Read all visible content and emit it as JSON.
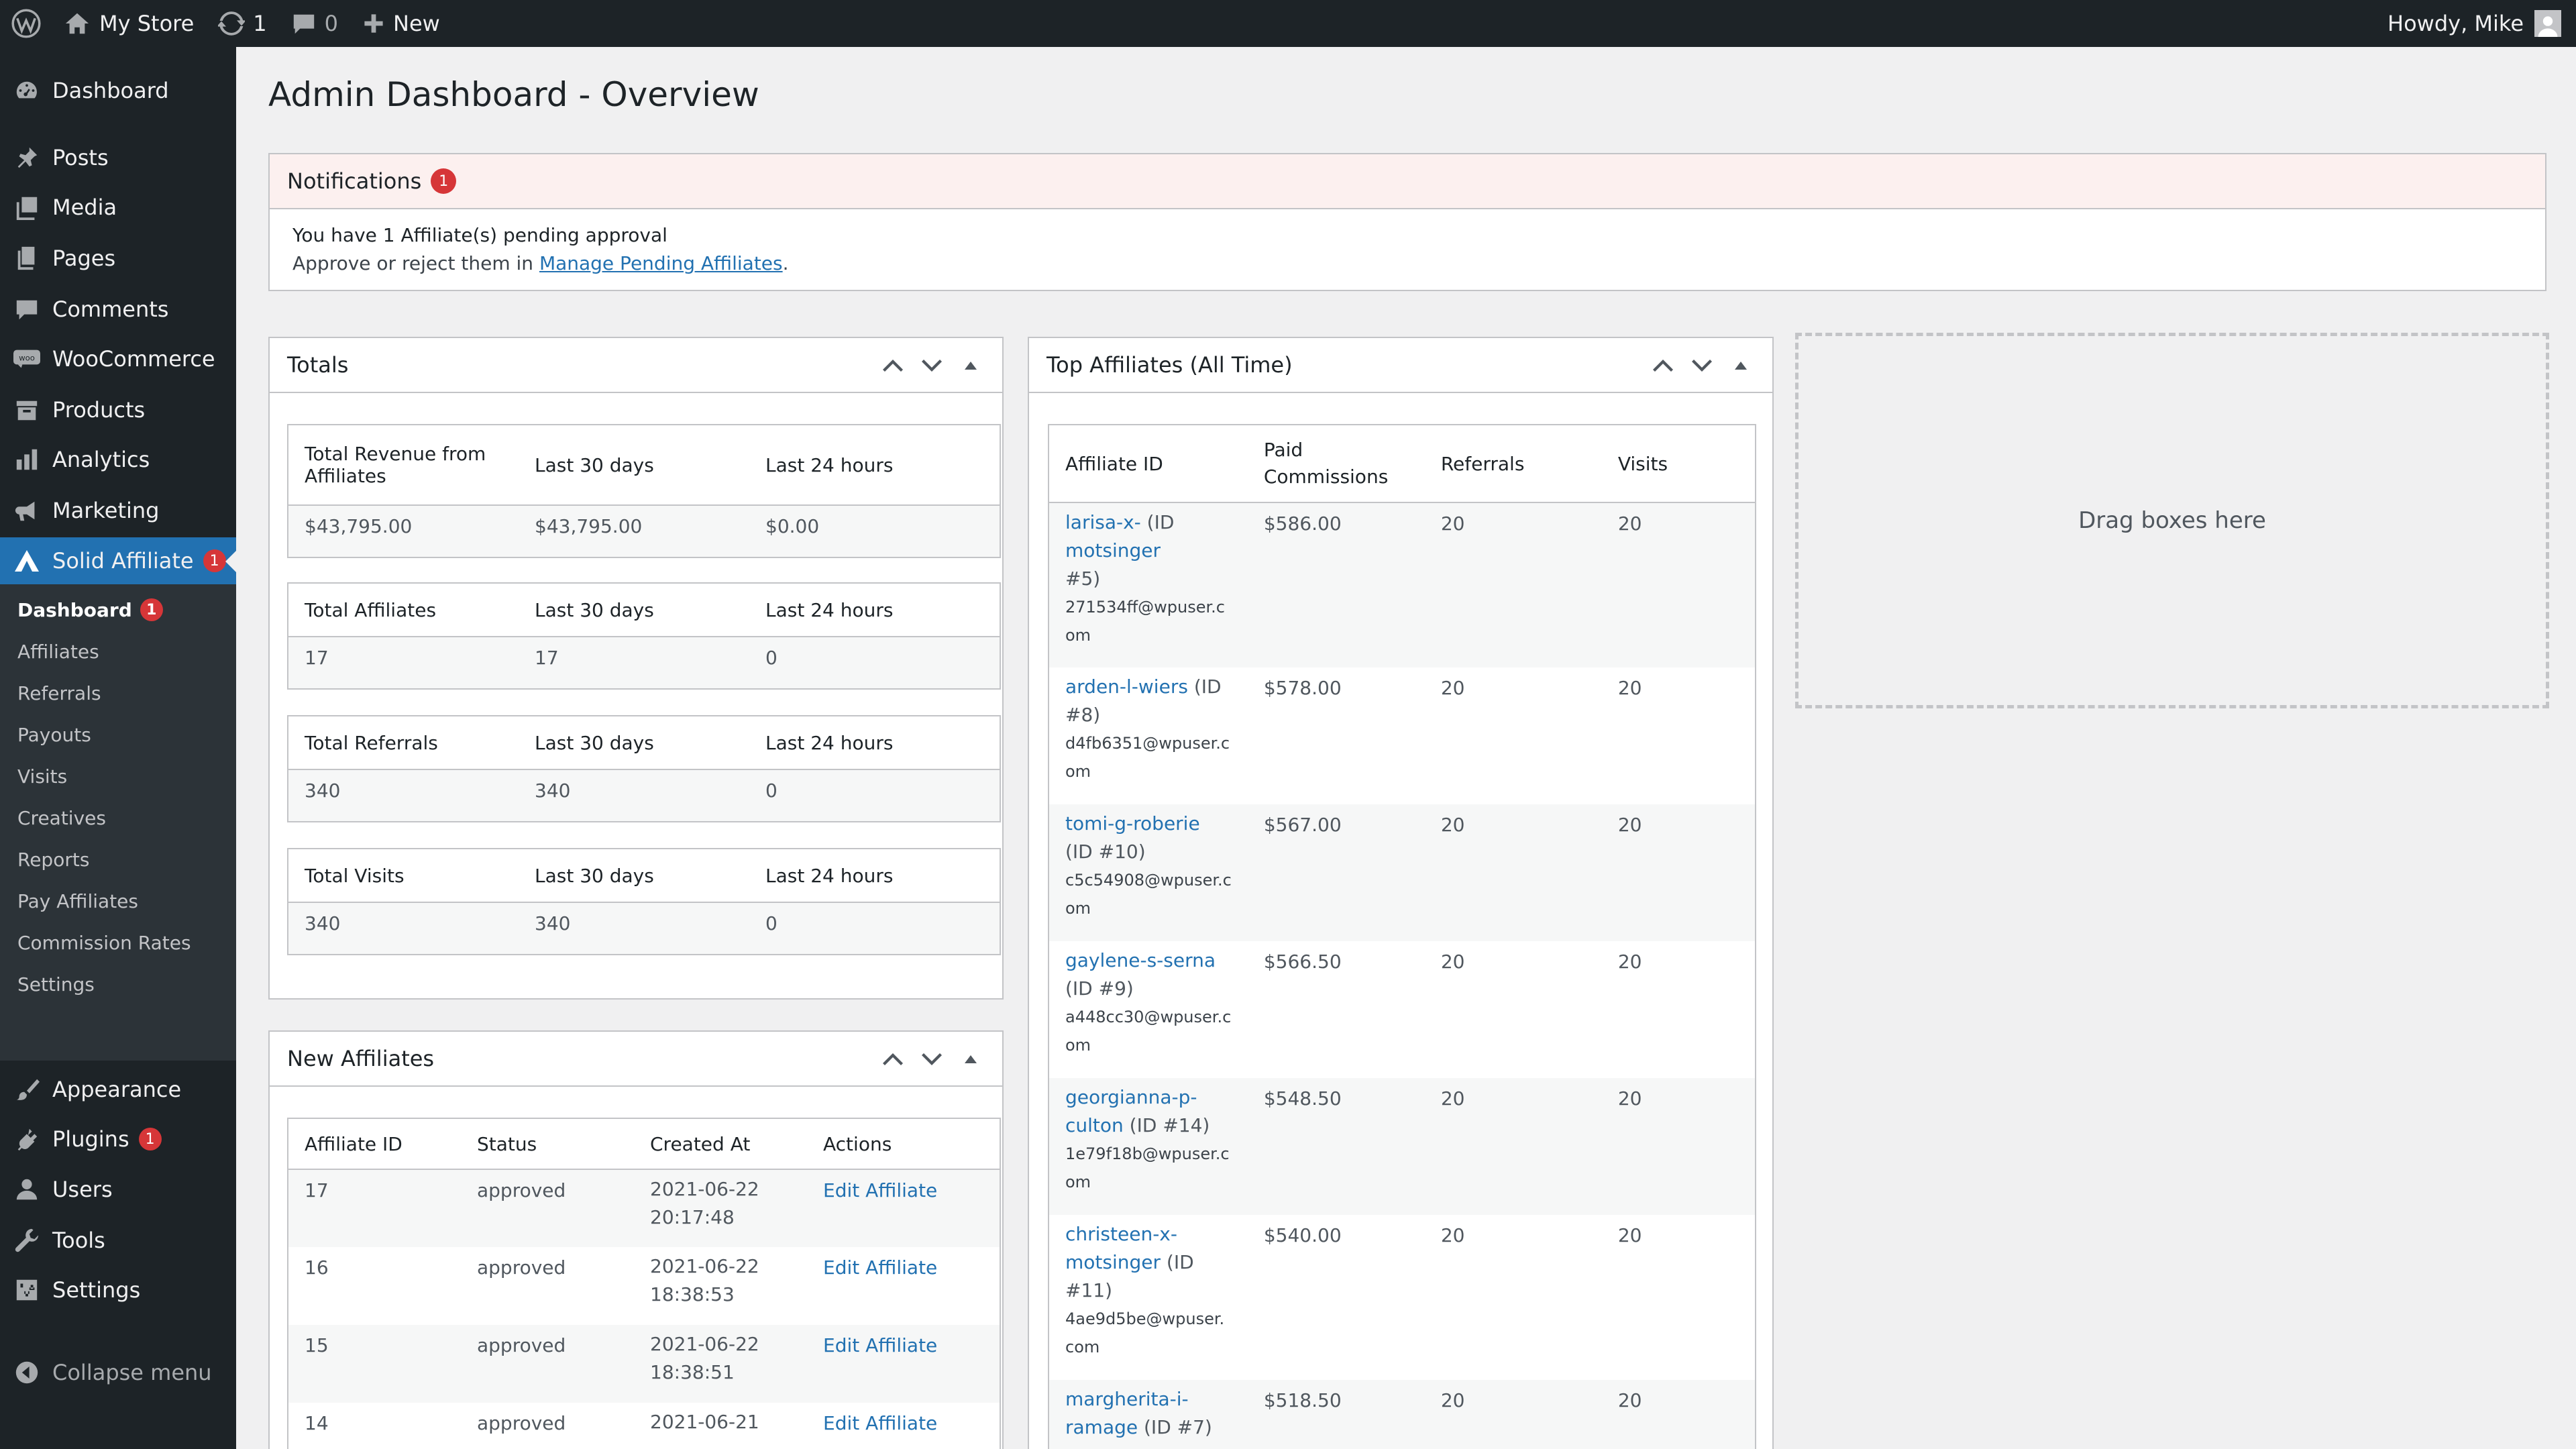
{
  "admin_bar": {
    "site_name": "My Store",
    "updates_count": "1",
    "comments_count": "0",
    "new_label": "New",
    "howdy": "Howdy, Mike"
  },
  "sidebar": {
    "items": [
      {
        "label": "Dashboard",
        "icon": "dashboard-icon"
      },
      {
        "label": "Posts",
        "icon": "pushpin-icon"
      },
      {
        "label": "Media",
        "icon": "media-icon"
      },
      {
        "label": "Pages",
        "icon": "pages-icon"
      },
      {
        "label": "Comments",
        "icon": "comment-icon"
      },
      {
        "label": "WooCommerce",
        "icon": "woocommerce-icon"
      },
      {
        "label": "Products",
        "icon": "archive-icon"
      },
      {
        "label": "Analytics",
        "icon": "bar-chart-icon"
      },
      {
        "label": "Marketing",
        "icon": "megaphone-icon"
      },
      {
        "label": "Solid Affiliate",
        "icon": "solid-affiliate-icon",
        "badge": "1"
      }
    ],
    "submenu": [
      {
        "label": "Dashboard",
        "badge": "1"
      },
      {
        "label": "Affiliates"
      },
      {
        "label": "Referrals"
      },
      {
        "label": "Payouts"
      },
      {
        "label": "Visits"
      },
      {
        "label": "Creatives"
      },
      {
        "label": "Reports"
      },
      {
        "label": "Pay Affiliates"
      },
      {
        "label": "Commission Rates"
      },
      {
        "label": "Settings"
      }
    ],
    "bottom_items": [
      {
        "label": "Appearance",
        "icon": "paintbrush-icon"
      },
      {
        "label": "Plugins",
        "icon": "plugin-icon",
        "badge": "1"
      },
      {
        "label": "Users",
        "icon": "user-icon"
      },
      {
        "label": "Tools",
        "icon": "wrench-icon"
      },
      {
        "label": "Settings",
        "icon": "settings-icon"
      }
    ],
    "collapse_label": "Collapse menu"
  },
  "page_title": "Admin Dashboard - Overview",
  "notifications": {
    "title": "Notifications",
    "badge": "1",
    "line1": "You have 1 Affiliate(s) pending approval",
    "line2_prefix": "Approve or reject them in ",
    "line2_link": "Manage Pending Affiliates",
    "line2_suffix": "."
  },
  "totals": {
    "title": "Totals",
    "tables": [
      {
        "headers": [
          "Total Revenue from Affiliates",
          "Last 30 days",
          "Last 24 hours"
        ],
        "values": [
          "$43,795.00",
          "$43,795.00",
          "$0.00"
        ]
      },
      {
        "headers": [
          "Total Affiliates",
          "Last 30 days",
          "Last 24 hours"
        ],
        "values": [
          "17",
          "17",
          "0"
        ]
      },
      {
        "headers": [
          "Total Referrals",
          "Last 30 days",
          "Last 24 hours"
        ],
        "values": [
          "340",
          "340",
          "0"
        ]
      },
      {
        "headers": [
          "Total Visits",
          "Last 30 days",
          "Last 24 hours"
        ],
        "values": [
          "340",
          "340",
          "0"
        ]
      }
    ]
  },
  "new_affiliates": {
    "title": "New Affiliates",
    "headers": [
      "Affiliate ID",
      "Status",
      "Created At",
      "Actions"
    ],
    "rows": [
      {
        "id": "17",
        "status": "approved",
        "date": "2021-06-22",
        "time": "20:17:48",
        "action": "Edit Affiliate"
      },
      {
        "id": "16",
        "status": "approved",
        "date": "2021-06-22",
        "time": "18:38:53",
        "action": "Edit Affiliate"
      },
      {
        "id": "15",
        "status": "approved",
        "date": "2021-06-22",
        "time": "18:38:51",
        "action": "Edit Affiliate"
      },
      {
        "id": "14",
        "status": "approved",
        "date": "2021-06-21",
        "time": "",
        "action": "Edit Affiliate"
      }
    ]
  },
  "top_affiliates": {
    "title": "Top Affiliates (All Time)",
    "headers": [
      "Affiliate ID",
      "Paid Commissions",
      "Referrals",
      "Visits"
    ],
    "rows": [
      {
        "name_l1": "larisa-x-",
        "name_l2": "motsinger",
        "id_l1": " (ID",
        "id_l2": "#5)",
        "email_l1": "271534ff@wpuser.c",
        "email_l2": "om",
        "paid": "$586.00",
        "referrals": "20",
        "visits": "20"
      },
      {
        "name_l1": "arden-l-wiers",
        "name_l2": "",
        "id_l1": " (ID",
        "id_l2": "#8)",
        "email_l1": "d4fb6351@wpuser.c",
        "email_l2": "om",
        "paid": "$578.00",
        "referrals": "20",
        "visits": "20"
      },
      {
        "name_l1": "tomi-g-roberie",
        "name_l2": "",
        "id_l1": "",
        "id_l2": "(ID #10)",
        "email_l1": "c5c54908@wpuser.c",
        "email_l2": "om",
        "paid": "$567.00",
        "referrals": "20",
        "visits": "20"
      },
      {
        "name_l1": "gaylene-s-serna",
        "name_l2": "",
        "id_l1": "",
        "id_l2": "(ID #9)",
        "email_l1": "a448cc30@wpuser.c",
        "email_l2": "om",
        "paid": "$566.50",
        "referrals": "20",
        "visits": "20"
      },
      {
        "name_l1": "georgianna-p-",
        "name_l2": "culton",
        "id_l1": "",
        "id_l2": " (ID #14)",
        "email_l1": "1e79f18b@wpuser.c",
        "email_l2": "om",
        "paid": "$548.50",
        "referrals": "20",
        "visits": "20"
      },
      {
        "name_l1": "christeen-x-",
        "name_l2": "motsinger",
        "id_l1": "",
        "id_l2": " (ID",
        "id_l3": "#11)",
        "email_l1": "4ae9d5be@wpuser.",
        "email_l2": "com",
        "paid": "$540.00",
        "referrals": "20",
        "visits": "20"
      },
      {
        "name_l1": "margherita-i-",
        "name_l2": "ramage",
        "id_l1": "",
        "id_l2": " (ID #7)",
        "email_l1": "",
        "email_l2": "",
        "paid": "$518.50",
        "referrals": "20",
        "visits": "20"
      }
    ]
  },
  "dropzone_label": "Drag boxes here",
  "colors": {
    "accent": "#2271b1",
    "admin_bg": "#1d2327",
    "badge": "#d63638",
    "notification_bg": "#fcf0ef"
  }
}
